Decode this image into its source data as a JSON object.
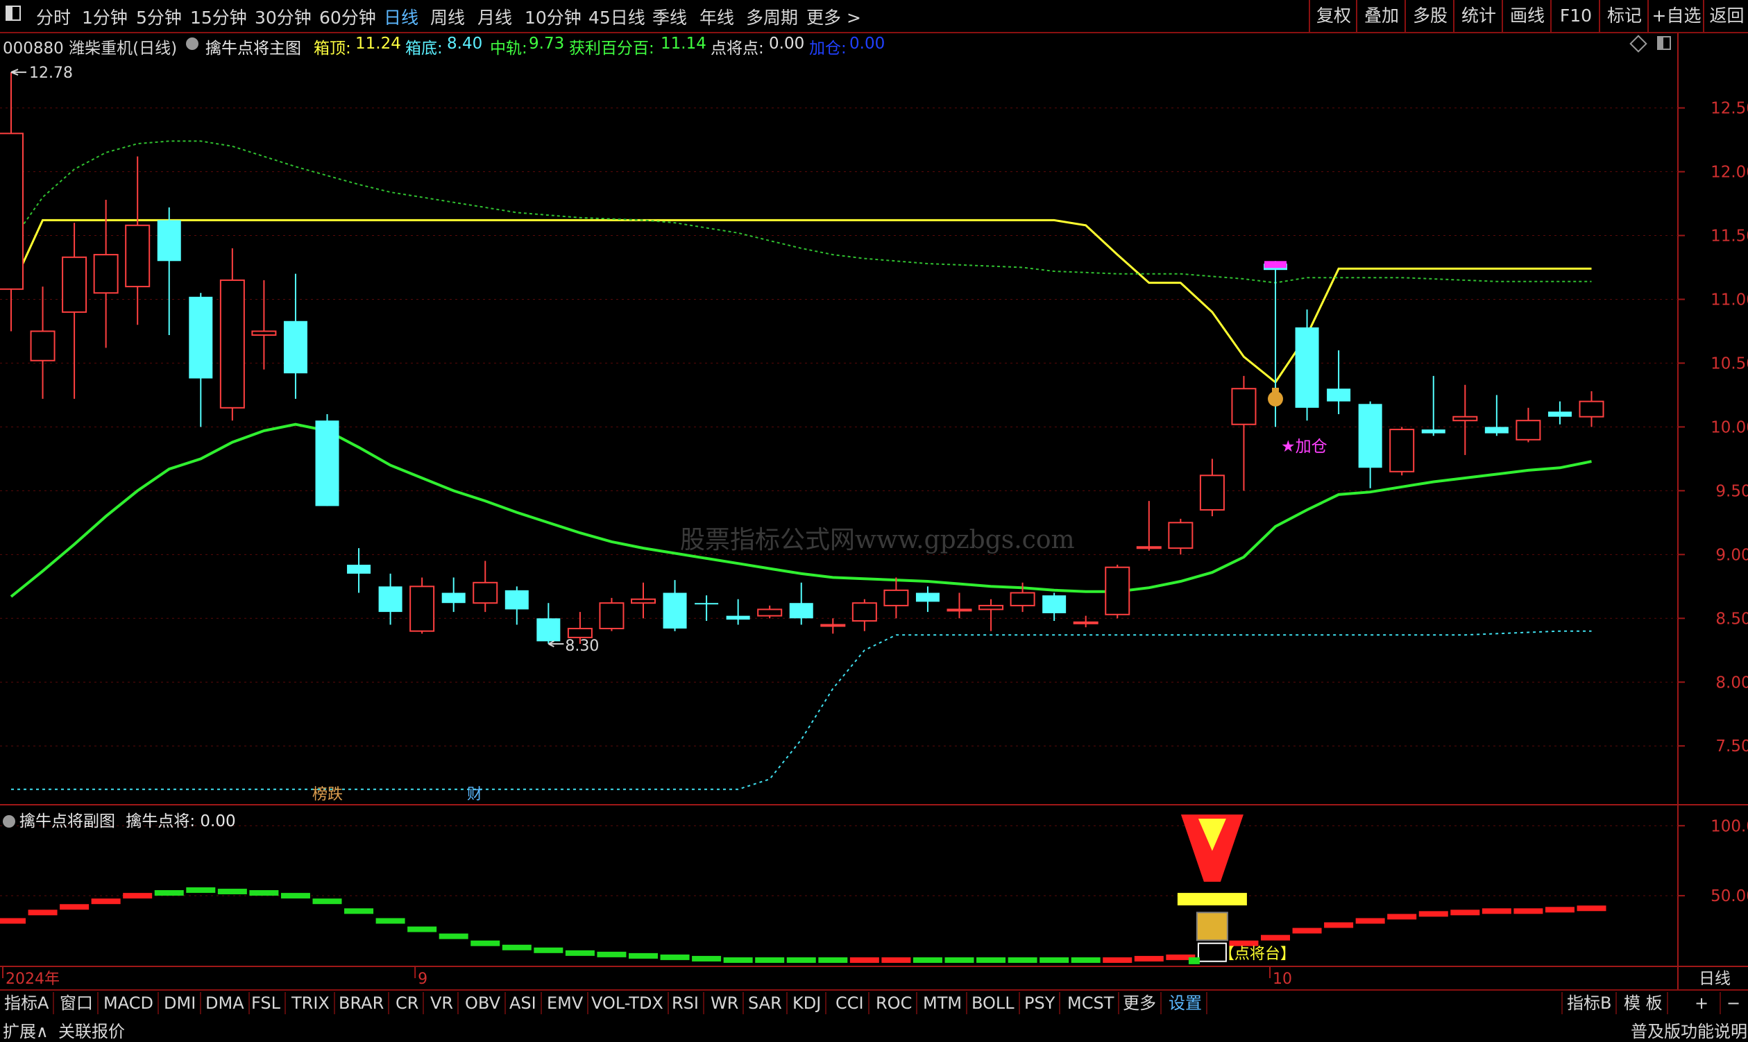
{
  "toolbar": {
    "window_icon": "window-toggle-icon",
    "periods": [
      "分时",
      "1分钟",
      "5分钟",
      "15分钟",
      "30分钟",
      "60分钟",
      "日线",
      "周线",
      "月线",
      "10分钟",
      "45日线",
      "季线",
      "年线",
      "多周期",
      "更多 >"
    ],
    "active_period": "日线",
    "right_buttons": [
      "复权",
      "叠加",
      "多股",
      "统计",
      "画线",
      "F10",
      "标记",
      "+自选",
      "返回"
    ]
  },
  "info": {
    "code_name": "000880 潍柴重机(日线)",
    "indicator_name": "擒牛点将主图",
    "items": [
      {
        "label": "箱顶:",
        "value": "11.24",
        "color": "#ffff40"
      },
      {
        "label": "箱底:",
        "value": "8.40",
        "color": "#5cf0ff"
      },
      {
        "label": "中轨:",
        "value": "9.73",
        "color": "#40ff40"
      },
      {
        "label": "获利百分百:",
        "value": "11.14",
        "color": "#40ff40"
      },
      {
        "label": "点将点:",
        "value": "0.00",
        "color": "#e0e0e0"
      },
      {
        "label": "加仓:",
        "value": "0.00",
        "color": "#2040ff"
      }
    ]
  },
  "price_axis": [
    "12.50",
    "12.00",
    "11.50",
    "11.00",
    "10.50",
    "10.00",
    "9.50",
    "9.00",
    "8.50",
    "8.00",
    "7.50"
  ],
  "sub_axis": [
    "100.0",
    "50.00"
  ],
  "annotations": {
    "high_label": "12.78",
    "low_label": "8.30",
    "jiacang": "★加仓",
    "dianjiangtai": "【点将台】",
    "bangdie": "榜跌",
    "cai": "财",
    "watermark": "股票指标公式网www.gpzbgs.com"
  },
  "sub_chart": {
    "title": "擒牛点将副图",
    "label": "擒牛点将:",
    "value": "0.00"
  },
  "date_axis": [
    "2024年",
    "9",
    "10"
  ],
  "date_axis_right": "日线",
  "bottom_tabs": [
    "指标A",
    "窗口",
    "MACD",
    "DMI",
    "DMA",
    "FSL",
    "TRIX",
    "BRAR",
    "CR",
    "VR",
    "OBV",
    "ASI",
    "EMV",
    "VOL-TDX",
    "RSI",
    "WR",
    "SAR",
    "KDJ",
    "CCI",
    "ROC",
    "MTM",
    "BOLL",
    "PSY",
    "MCST",
    "更多",
    "设置"
  ],
  "bottom_right": [
    "指标B",
    "模 板",
    "+",
    "−"
  ],
  "status": {
    "left": [
      "扩展∧",
      "关联报价"
    ],
    "right": "普及版功能说明"
  },
  "chart_data": {
    "type": "candlestick",
    "ylim": [
      7.05,
      12.9
    ],
    "candles": [
      {
        "o": 11.08,
        "c": 12.3,
        "h": 12.78,
        "l": 10.75
      },
      {
        "o": 10.52,
        "c": 10.75,
        "h": 11.1,
        "l": 10.22
      },
      {
        "o": 10.9,
        "c": 11.33,
        "h": 11.6,
        "l": 10.22
      },
      {
        "o": 11.05,
        "c": 11.35,
        "h": 11.78,
        "l": 10.62
      },
      {
        "o": 11.1,
        "c": 11.58,
        "h": 12.12,
        "l": 10.8
      },
      {
        "o": 11.62,
        "c": 11.3,
        "h": 11.72,
        "l": 10.72
      },
      {
        "o": 11.02,
        "c": 10.38,
        "h": 11.05,
        "l": 10.0
      },
      {
        "o": 10.15,
        "c": 11.15,
        "h": 11.4,
        "l": 10.05
      },
      {
        "o": 10.72,
        "c": 10.75,
        "h": 11.15,
        "l": 10.45
      },
      {
        "o": 10.83,
        "c": 10.42,
        "h": 11.2,
        "l": 10.22
      },
      {
        "o": 10.05,
        "c": 9.38,
        "h": 10.1,
        "l": 9.38
      },
      {
        "o": 8.92,
        "c": 8.85,
        "h": 9.05,
        "l": 8.7
      },
      {
        "o": 8.75,
        "c": 8.55,
        "h": 8.85,
        "l": 8.45
      },
      {
        "o": 8.4,
        "c": 8.75,
        "h": 8.82,
        "l": 8.38
      },
      {
        "o": 8.7,
        "c": 8.62,
        "h": 8.82,
        "l": 8.55
      },
      {
        "o": 8.62,
        "c": 8.78,
        "h": 8.95,
        "l": 8.55
      },
      {
        "o": 8.72,
        "c": 8.57,
        "h": 8.75,
        "l": 8.45
      },
      {
        "o": 8.5,
        "c": 8.32,
        "h": 8.62,
        "l": 8.3
      },
      {
        "o": 8.35,
        "c": 8.42,
        "h": 8.55,
        "l": 8.3
      },
      {
        "o": 8.42,
        "c": 8.62,
        "h": 8.66,
        "l": 8.4
      },
      {
        "o": 8.62,
        "c": 8.65,
        "h": 8.78,
        "l": 8.5
      },
      {
        "o": 8.7,
        "c": 8.42,
        "h": 8.8,
        "l": 8.4
      },
      {
        "o": 8.62,
        "c": 8.61,
        "h": 8.68,
        "l": 8.48
      },
      {
        "o": 8.52,
        "c": 8.49,
        "h": 8.65,
        "l": 8.45
      },
      {
        "o": 8.52,
        "c": 8.57,
        "h": 8.6,
        "l": 8.5
      },
      {
        "o": 8.62,
        "c": 8.5,
        "h": 8.78,
        "l": 8.45
      },
      {
        "o": 8.45,
        "c": 8.45,
        "h": 8.5,
        "l": 8.38
      },
      {
        "o": 8.48,
        "c": 8.62,
        "h": 8.65,
        "l": 8.4
      },
      {
        "o": 8.6,
        "c": 8.72,
        "h": 8.82,
        "l": 8.5
      },
      {
        "o": 8.7,
        "c": 8.63,
        "h": 8.75,
        "l": 8.55
      },
      {
        "o": 8.57,
        "c": 8.57,
        "h": 8.7,
        "l": 8.5
      },
      {
        "o": 8.57,
        "c": 8.6,
        "h": 8.65,
        "l": 8.4
      },
      {
        "o": 8.6,
        "c": 8.7,
        "h": 8.78,
        "l": 8.55
      },
      {
        "o": 8.68,
        "c": 8.54,
        "h": 8.7,
        "l": 8.48
      },
      {
        "o": 8.47,
        "c": 8.47,
        "h": 8.52,
        "l": 8.43
      },
      {
        "o": 8.53,
        "c": 8.9,
        "h": 8.92,
        "l": 8.5
      },
      {
        "o": 9.06,
        "c": 9.06,
        "h": 9.42,
        "l": 9.03
      },
      {
        "o": 9.05,
        "c": 9.25,
        "h": 9.28,
        "l": 9.0
      },
      {
        "o": 9.35,
        "c": 9.62,
        "h": 9.75,
        "l": 9.3
      },
      {
        "o": 10.02,
        "c": 10.3,
        "h": 10.4,
        "l": 9.5
      },
      {
        "o": 11.28,
        "c": 11.23,
        "h": 11.3,
        "l": 10.0
      },
      {
        "o": 10.78,
        "c": 10.15,
        "h": 10.92,
        "l": 10.05
      },
      {
        "o": 10.3,
        "c": 10.2,
        "h": 10.6,
        "l": 10.1
      },
      {
        "o": 10.18,
        "c": 9.68,
        "h": 10.2,
        "l": 9.52
      },
      {
        "o": 9.65,
        "c": 9.98,
        "h": 10.0,
        "l": 9.62
      },
      {
        "o": 9.98,
        "c": 9.95,
        "h": 10.4,
        "l": 9.93
      },
      {
        "o": 10.05,
        "c": 10.08,
        "h": 10.33,
        "l": 9.78
      },
      {
        "o": 10.0,
        "c": 9.95,
        "h": 10.25,
        "l": 9.93
      },
      {
        "o": 9.9,
        "c": 10.05,
        "h": 10.15,
        "l": 9.88
      },
      {
        "o": 10.12,
        "c": 10.08,
        "h": 10.2,
        "l": 10.02
      },
      {
        "o": 10.08,
        "c": 10.2,
        "h": 10.28,
        "l": 10.0
      }
    ],
    "series": [
      {
        "name": "箱顶",
        "values": [
          11.08,
          11.62,
          11.62,
          11.62,
          11.62,
          11.62,
          11.62,
          11.62,
          11.62,
          11.62,
          11.62,
          11.62,
          11.62,
          11.62,
          11.62,
          11.62,
          11.62,
          11.62,
          11.62,
          11.62,
          11.62,
          11.62,
          11.62,
          11.62,
          11.62,
          11.62,
          11.62,
          11.62,
          11.62,
          11.62,
          11.62,
          11.62,
          11.62,
          11.62,
          11.58,
          11.35,
          11.13,
          11.13,
          10.9,
          10.55,
          10.35,
          10.72,
          11.24,
          11.24,
          11.24,
          11.24,
          11.24,
          11.24,
          11.24,
          11.24,
          11.24
        ]
      },
      {
        "name": "中轨",
        "values": [
          8.67,
          8.87,
          9.08,
          9.3,
          9.5,
          9.67,
          9.75,
          9.88,
          9.97,
          10.02,
          9.97,
          9.84,
          9.7,
          9.6,
          9.5,
          9.42,
          9.33,
          9.25,
          9.17,
          9.1,
          9.05,
          9.01,
          8.97,
          8.93,
          8.89,
          8.85,
          8.82,
          8.81,
          8.8,
          8.79,
          8.77,
          8.75,
          8.74,
          8.72,
          8.71,
          8.71,
          8.74,
          8.79,
          8.86,
          8.98,
          9.22,
          9.35,
          9.47,
          9.49,
          9.53,
          9.57,
          9.6,
          9.63,
          9.66,
          9.68,
          9.73
        ]
      },
      {
        "name": "获利百分百",
        "values": [
          11.45,
          11.8,
          12.02,
          12.15,
          12.22,
          12.24,
          12.24,
          12.2,
          12.12,
          12.04,
          11.97,
          11.9,
          11.84,
          11.8,
          11.76,
          11.72,
          11.68,
          11.66,
          11.64,
          11.63,
          11.62,
          11.6,
          11.56,
          11.52,
          11.46,
          11.4,
          11.35,
          11.32,
          11.3,
          11.28,
          11.27,
          11.26,
          11.25,
          11.22,
          11.21,
          11.2,
          11.2,
          11.2,
          11.18,
          11.16,
          11.13,
          11.17,
          11.17,
          11.17,
          11.17,
          11.16,
          11.15,
          11.14,
          11.14,
          11.14,
          11.14
        ]
      },
      {
        "name": "箱底",
        "values": [
          7.16,
          7.16,
          7.16,
          7.16,
          7.16,
          7.16,
          7.16,
          7.16,
          7.16,
          7.16,
          7.16,
          7.16,
          7.16,
          7.16,
          7.16,
          7.16,
          7.16,
          7.16,
          7.16,
          7.16,
          7.16,
          7.16,
          7.16,
          7.16,
          7.24,
          7.55,
          7.95,
          8.25,
          8.37,
          8.37,
          8.37,
          8.37,
          8.37,
          8.37,
          8.37,
          8.37,
          8.37,
          8.37,
          8.37,
          8.37,
          8.37,
          8.37,
          8.37,
          8.37,
          8.37,
          8.37,
          8.37,
          8.38,
          8.39,
          8.4,
          8.4
        ]
      }
    ],
    "sub_series": {
      "name": "擒牛点将",
      "ylim": [
        0,
        115
      ],
      "values": [
        32,
        38,
        42,
        46,
        50,
        52,
        54,
        53,
        52,
        50,
        46,
        39,
        32,
        26,
        21,
        16,
        13,
        11,
        9,
        8,
        7,
        6,
        5,
        4,
        4,
        4,
        4,
        4,
        4,
        4,
        4,
        4,
        4,
        4,
        4,
        4,
        5,
        6,
        7,
        16,
        20,
        25,
        29,
        32,
        35,
        37,
        38,
        39,
        39,
        40,
        41
      ],
      "colors": [
        "r",
        "r",
        "r",
        "r",
        "r",
        "g",
        "g",
        "g",
        "g",
        "g",
        "g",
        "g",
        "g",
        "g",
        "g",
        "g",
        "g",
        "g",
        "g",
        "g",
        "g",
        "g",
        "g",
        "g",
        "g",
        "g",
        "g",
        "r",
        "r",
        "g",
        "g",
        "g",
        "g",
        "g",
        "g",
        "r",
        "r",
        "r",
        "r",
        "r",
        "r",
        "r",
        "r",
        "r",
        "r",
        "r",
        "r",
        "r",
        "r",
        "r",
        "r"
      ]
    }
  }
}
